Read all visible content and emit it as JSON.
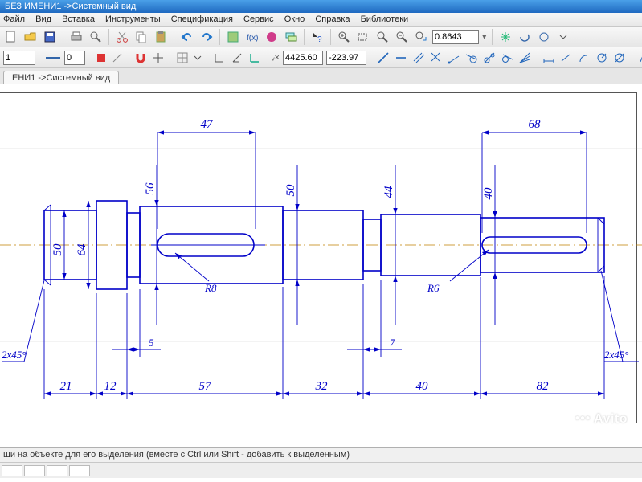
{
  "title": "БЕЗ ИМЕНИ1 ->Системный вид",
  "menu": {
    "file": "Файл",
    "view": "Вид",
    "insert": "Вставка",
    "tools": "Инструменты",
    "spec": "Спецификация",
    "service": "Сервис",
    "window": "Окно",
    "help": "Справка",
    "libs": "Библиотеки"
  },
  "toolbar": {
    "zoom_value": "0.8643",
    "coord_x": "4425.60",
    "coord_y": "-223.97",
    "style_num": "0",
    "style_label": "1"
  },
  "tab": {
    "label": "ЕНИ1 ->Системный вид"
  },
  "status": {
    "hint": "ши на объекте для его выделения (вместе с Ctrl или Shift - добавить к выделенным)"
  },
  "dims": {
    "top1": "47",
    "top2": "68",
    "v56": "56",
    "v50b": "50",
    "v44": "44",
    "v40": "40",
    "v50a": "50",
    "v64": "64",
    "r8": "R8",
    "r6": "R6",
    "l21": "21",
    "l12": "12",
    "l57": "57",
    "l32": "32",
    "l40": "40",
    "l82": "82",
    "g5": "5",
    "g7": "7",
    "ch1": "2x45°",
    "ch2": "2x45°"
  },
  "watermark": "Avito"
}
